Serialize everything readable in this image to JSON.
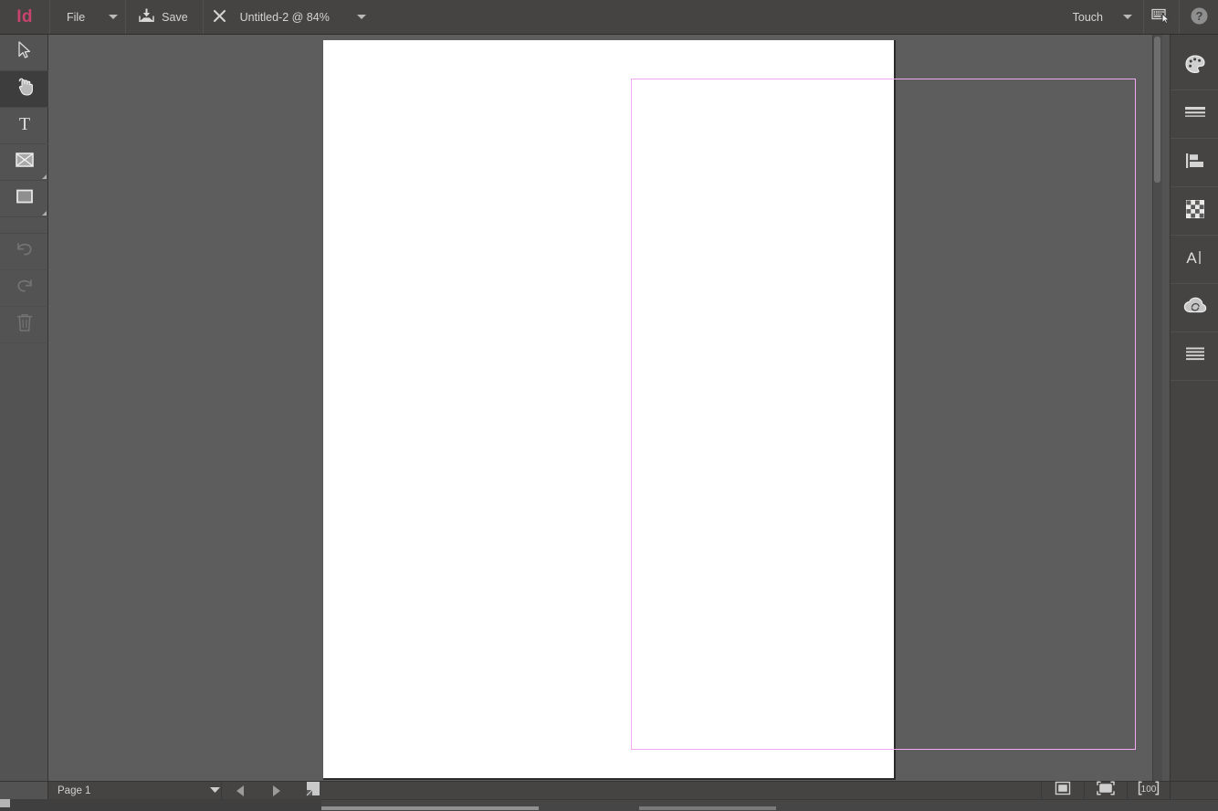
{
  "app": {
    "logo_text": "Id",
    "name": "Adobe InDesign"
  },
  "topbar": {
    "file_menu_label": "File",
    "file_menu_icon": "chevron-down-icon",
    "save_label": "Save",
    "save_icon": "save-download-icon",
    "close_doc_icon": "close-x-icon",
    "document_tab_label": "Untitled-2 @ 84%",
    "document_tab_icon": "chevron-down-icon",
    "workspace_label": "Touch",
    "workspace_icon": "chevron-down-icon",
    "keyboard_toggle_icon": "keyboard-cursor-icon",
    "help_icon": "help-question-icon"
  },
  "tools": [
    {
      "name": "selection-tool",
      "icon": "arrow-cursor-icon",
      "active": false,
      "disabled": false,
      "flyout": false
    },
    {
      "name": "hand-tool",
      "icon": "hand-touch-icon",
      "active": true,
      "disabled": false,
      "flyout": false
    },
    {
      "name": "type-tool",
      "icon": "type-t-icon",
      "active": false,
      "disabled": false,
      "flyout": false
    },
    {
      "name": "frame-tool",
      "icon": "frame-x-box-icon",
      "active": false,
      "disabled": false,
      "flyout": true
    },
    {
      "name": "rectangle-tool",
      "icon": "rectangle-icon",
      "active": false,
      "disabled": false,
      "flyout": true
    },
    {
      "name": "undo-tool",
      "icon": "undo-arrow-icon",
      "active": false,
      "disabled": true,
      "flyout": false
    },
    {
      "name": "redo-tool",
      "icon": "redo-arrow-icon",
      "active": false,
      "disabled": true,
      "flyout": false
    },
    {
      "name": "delete-tool",
      "icon": "trash-can-icon",
      "active": false,
      "disabled": true,
      "flyout": false
    }
  ],
  "panels": [
    {
      "name": "color-panel",
      "icon": "color-palette-icon"
    },
    {
      "name": "stroke-panel",
      "icon": "stroke-lines-icon"
    },
    {
      "name": "align-panel",
      "icon": "align-left-icon"
    },
    {
      "name": "effects-panel",
      "icon": "transparency-checker-icon"
    },
    {
      "name": "character-panel",
      "icon": "text-a-cursor-icon"
    },
    {
      "name": "cc-libraries-panel",
      "icon": "creative-cloud-icon"
    },
    {
      "name": "paragraph-panel",
      "icon": "paragraph-lines-icon"
    }
  ],
  "document": {
    "page_background": "#ffffff",
    "pasteboard_color": "#5d5d5d",
    "margin_guide_color": "#f3a8f3",
    "zoom_level": "84%",
    "title": "Untitled-2"
  },
  "statusbar": {
    "page_label": "Page 1",
    "page_dropdown_icon": "chevron-down-icon",
    "prev_page_icon": "triangle-left-icon",
    "next_page_icon": "triangle-right-icon",
    "add_page_icon": "new-page-icon",
    "view_normal_icon": "normal-view-icon",
    "view_preview_icon": "preview-view-icon",
    "view_presentation_icon": "presentation-view-icon"
  },
  "colors": {
    "topbar_bg": "#454443",
    "toolbar_bg": "#535353",
    "panel_bg": "#454443",
    "canvas_bg": "#5d5d5d",
    "logo_accent": "#c8436f",
    "text": "#d4d4d4"
  }
}
